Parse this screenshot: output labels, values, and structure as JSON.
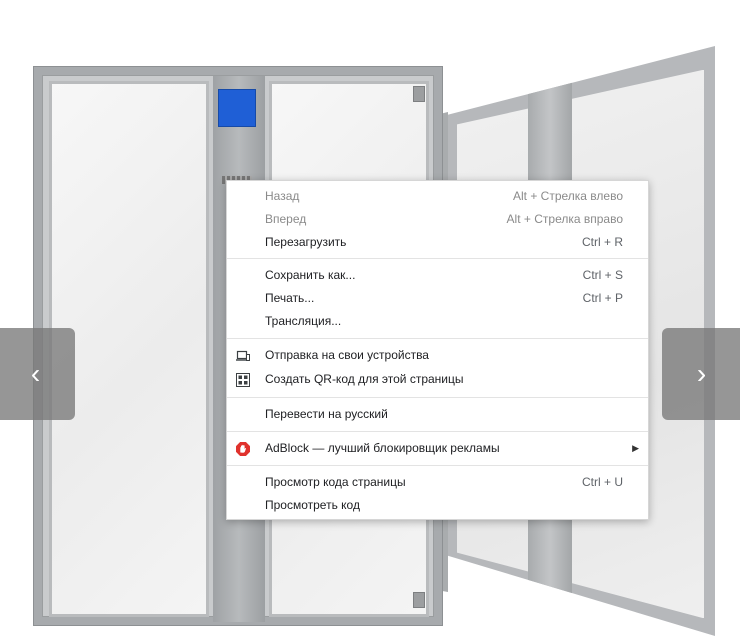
{
  "gallery": {
    "prev_arrow": "‹",
    "next_arrow": "›"
  },
  "product_image": {
    "accent_color": "#1f5fd6",
    "frame_color": "#a7aaad"
  },
  "context_menu": {
    "items": [
      {
        "label": "Назад",
        "shortcut": "Alt + Стрелка влево",
        "enabled": false
      },
      {
        "label": "Вперед",
        "shortcut": "Alt + Стрелка вправо",
        "enabled": false
      },
      {
        "label": "Перезагрузить",
        "shortcut": "Ctrl + R",
        "enabled": true
      },
      {
        "label": "Сохранить как...",
        "shortcut": "Ctrl + S",
        "enabled": true
      },
      {
        "label": "Печать...",
        "shortcut": "Ctrl + P",
        "enabled": true
      },
      {
        "label": "Трансляция...",
        "shortcut": "",
        "enabled": true
      },
      {
        "label": "Отправка на свои устройства",
        "shortcut": "",
        "enabled": true,
        "icon": "devices-icon"
      },
      {
        "label": "Создать QR-код для этой страницы",
        "shortcut": "",
        "enabled": true,
        "icon": "qr-code-icon"
      },
      {
        "label": "Перевести на русский",
        "shortcut": "",
        "enabled": true
      },
      {
        "label": "AdBlock — лучший блокировщик рекламы",
        "shortcut": "",
        "enabled": true,
        "icon": "adblock-icon",
        "submenu": true
      },
      {
        "label": "Просмотр кода страницы",
        "shortcut": "Ctrl + U",
        "enabled": true
      },
      {
        "label": "Просмотреть код",
        "shortcut": "",
        "enabled": true
      }
    ]
  }
}
